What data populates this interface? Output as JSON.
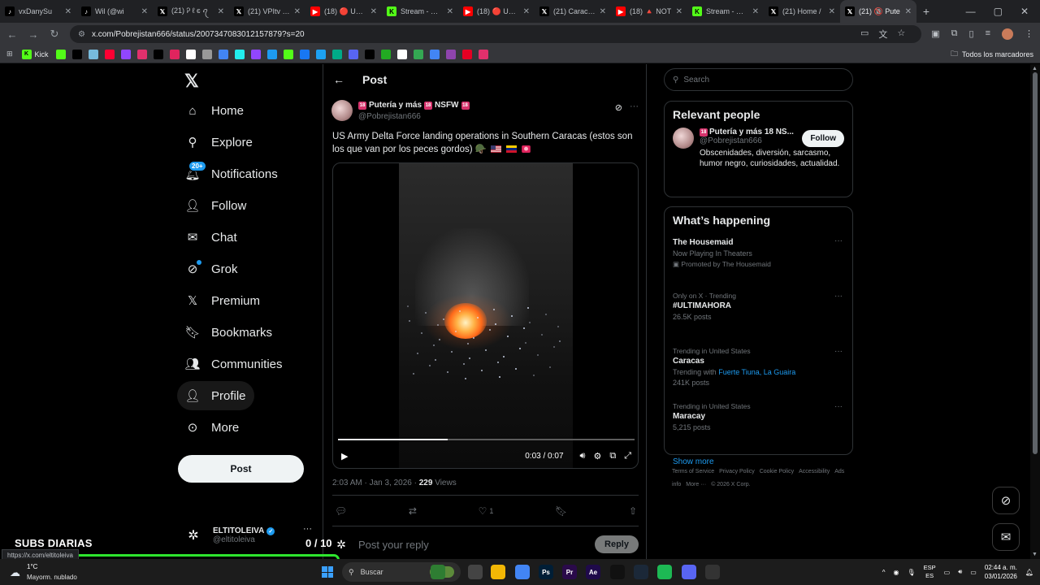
{
  "browser": {
    "tabs": [
      {
        "label": "vxDanySu",
        "icon": "tiktok-icon",
        "color": "#000000"
      },
      {
        "label": "Wil (@wi",
        "icon": "tiktok-icon",
        "color": "#000000"
      },
      {
        "label": "(21) Ꭾ ℓ є ꪖ",
        "icon": "x-icon",
        "color": "#000000"
      },
      {
        "label": "(21) VPItv on",
        "icon": "x-icon",
        "color": "#000000"
      },
      {
        "label": "(18) 🔴 URG",
        "icon": "youtube-icon",
        "color": "#ff0000"
      },
      {
        "label": "Stream - Kick",
        "icon": "kick-icon",
        "color": "#53fc18"
      },
      {
        "label": "(18) 🔴 URG",
        "icon": "youtube-icon",
        "color": "#ff0000"
      },
      {
        "label": "(21) Caracas",
        "icon": "x-icon",
        "color": "#000000"
      },
      {
        "label": "(18) 🔺 NOT",
        "icon": "youtube-icon",
        "color": "#ff0000"
      },
      {
        "label": "Stream - Kick",
        "icon": "kick-icon",
        "color": "#53fc18"
      },
      {
        "label": "(21) Home /",
        "icon": "x-icon",
        "color": "#000000"
      },
      {
        "label": "(21) 🔞 Pute",
        "icon": "x-icon",
        "color": "#000000",
        "active": true
      }
    ],
    "url": "x.com/Pobrejistan666/status/2007347083012157879?s=20",
    "bookmark_first": "Kick",
    "bookmarks_all": "Todos los marcadores"
  },
  "nav": {
    "items": [
      {
        "label": "Home",
        "icon": "home-icon"
      },
      {
        "label": "Explore",
        "icon": "search-icon"
      },
      {
        "label": "Notifications",
        "icon": "bell-icon",
        "badge": "20+"
      },
      {
        "label": "Follow",
        "icon": "add-person-icon"
      },
      {
        "label": "Chat",
        "icon": "mail-icon"
      },
      {
        "label": "Grok",
        "icon": "grok-icon"
      },
      {
        "label": "Premium",
        "icon": "x-icon"
      },
      {
        "label": "Bookmarks",
        "icon": "bookmark-icon"
      },
      {
        "label": "Communities",
        "icon": "people-icon"
      },
      {
        "label": "Profile",
        "icon": "person-icon"
      },
      {
        "label": "More",
        "icon": "more-circle-icon"
      }
    ],
    "post_button": "Post",
    "account": {
      "name": "ELTITOLEIVA",
      "handle": "@eltitoleiva"
    }
  },
  "post": {
    "header": "Post",
    "author_name_pre": "18",
    "author_name_mid": "Putería y más",
    "author_name_mid2": "18",
    "author_name_post": "NSFW",
    "author_name_end": "18",
    "author_handle": "@Pobrejistan666",
    "text": "US Army Delta Force landing operations in Southern Caracas (estos son los que van por los peces gordos) 🪖",
    "video_time": "0:03 / 0:07",
    "video_progress": 0.37,
    "timestamp": "2:03 AM · Jan 3, 2026 · ",
    "views_count": "229",
    "views_label": " Views",
    "likes": "1",
    "reply_placeholder": "Post your reply",
    "reply_button": "Reply"
  },
  "sidebar": {
    "search_placeholder": "Search",
    "relevant_title": "Relevant people",
    "person": {
      "name": "Putería y más 18 NS...",
      "handle": "@Pobrejistan666",
      "follow": "Follow",
      "bio": "Obscenidades, diversión, sarcasmo, humor negro, curiosidades, actualidad."
    },
    "happening_title": "What’s happening",
    "trends": [
      {
        "context": "",
        "name": "The Housemaid",
        "sub": "Now Playing In Theaters",
        "sub2": "Promoted by The Housemaid"
      },
      {
        "context": "Only on X · Trending",
        "name": "#ULTIMAHORA",
        "sub": "26.5K posts"
      },
      {
        "context": "Trending in United States",
        "name": "Caracas",
        "sub_pre": "Trending with ",
        "sub_links": "Fuerte Tiuna, La Guaira",
        "sub": "241K posts"
      },
      {
        "context": "Trending in United States",
        "name": "Maracay",
        "sub": "5,215 posts"
      }
    ],
    "show_more": "Show more",
    "footer": [
      "Terms of Service",
      "Privacy Policy",
      "Cookie Policy",
      "Accessibility",
      "Ads info",
      "More ···",
      "© 2026 X Corp."
    ]
  },
  "overlay": {
    "title": "SUBS DIARIAS",
    "count": "0 / 10",
    "status_url": "https://x.com/eltitoleiva"
  },
  "taskbar": {
    "weather_temp": "1°C",
    "weather_desc": "Mayorm. nublado",
    "search": "Buscar",
    "lang1": "ESP",
    "lang2": "ES",
    "time": "02:44 a. m.",
    "date": "03/01/2026"
  }
}
